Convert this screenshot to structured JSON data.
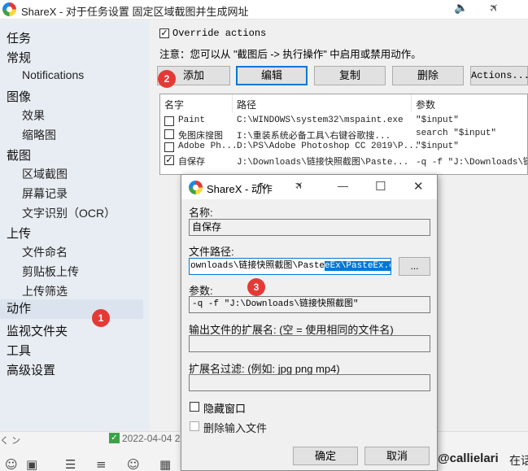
{
  "window": {
    "title": "ShareX - 对于任务设置 固定区域截图并生成网址",
    "speaker_glyph": "🔈",
    "pin_glyph": "✈"
  },
  "sidebar": {
    "items": [
      {
        "label": "任务",
        "level": 0
      },
      {
        "label": "常规",
        "level": 0
      },
      {
        "label": "Notifications",
        "level": 1
      },
      {
        "label": "图像",
        "level": 0
      },
      {
        "label": "效果",
        "level": 1
      },
      {
        "label": "缩略图",
        "level": 1
      },
      {
        "label": "截图",
        "level": 0
      },
      {
        "label": "区域截图",
        "level": 1
      },
      {
        "label": "屏幕记录",
        "level": 1
      },
      {
        "label": "文字识别（OCR）",
        "level": 1
      },
      {
        "label": "上传",
        "level": 0
      },
      {
        "label": "文件命名",
        "level": 1
      },
      {
        "label": "剪贴板上传",
        "level": 1
      },
      {
        "label": "上传筛选",
        "level": 1
      },
      {
        "label": "动作",
        "level": 0,
        "selected": true
      },
      {
        "label": "监视文件夹",
        "level": 0
      },
      {
        "label": "工具",
        "level": 0
      },
      {
        "label": "高级设置",
        "level": 0
      }
    ]
  },
  "badges": {
    "one": "1",
    "two": "2",
    "three": "3"
  },
  "actions": {
    "override_label": "Override actions",
    "override_checked": "✓",
    "note": "注意：您可以从 \"截图后 -> 执行操作\" 中启用或禁用动作。",
    "buttons": {
      "add": "添加",
      "edit": "编辑",
      "copy": "复制",
      "delete": "删除",
      "more": "Actions..."
    },
    "columns": {
      "name": "名字",
      "path": "路径",
      "args": "参数"
    },
    "rows": [
      {
        "checked": "",
        "name": "Paint",
        "path": "C:\\WINDOWS\\system32\\mspaint.exe",
        "args": "\"$input\""
      },
      {
        "checked": "",
        "name": "免图床搜图",
        "path": "I:\\重装系统必备工具\\右键谷歌搜...",
        "args": "search \"$input\""
      },
      {
        "checked": "",
        "name": "Adobe Ph...",
        "path": "D:\\PS\\Adobe Photoshop CC 2019\\P...",
        "args": "\"$input\""
      },
      {
        "checked": "✓",
        "name": "自保存",
        "path": "J:\\Downloads\\链接快照截图\\Paste...",
        "args": "-q -f \"J:\\Downloads\\链接"
      }
    ]
  },
  "dialog": {
    "title": "ShareX - 动作",
    "name_label": "名称:",
    "name_value": "自保存",
    "path_label": "文件路径:",
    "path_prefix": "ownloads\\链接快照截图\\Paste",
    "path_selected": "eEx\\PasteEx.exe",
    "browse_label": "...",
    "args_label": "参数:",
    "args_value": "-q -f \"J:\\Downloads\\链接快照截图\"",
    "ext_label": "输出文件的扩展名: (空 = 使用相同的文件名)",
    "ext_value": "",
    "filter_label": "扩展名过滤: (例如: jpg png mp4)",
    "filter_value": "",
    "hide_window_label": "隐藏窗口",
    "delete_input_label": "删除输入文件",
    "ok_label": "确定",
    "cancel_label": "取消",
    "minimize_glyph": "—",
    "maximize_glyph": "☐",
    "close_glyph": "✕"
  },
  "bottom": {
    "left_fragment": "く ン",
    "date_fragment": "2022-04-04 2",
    "user_text": "@callielari",
    "user_suffix": "在话"
  }
}
